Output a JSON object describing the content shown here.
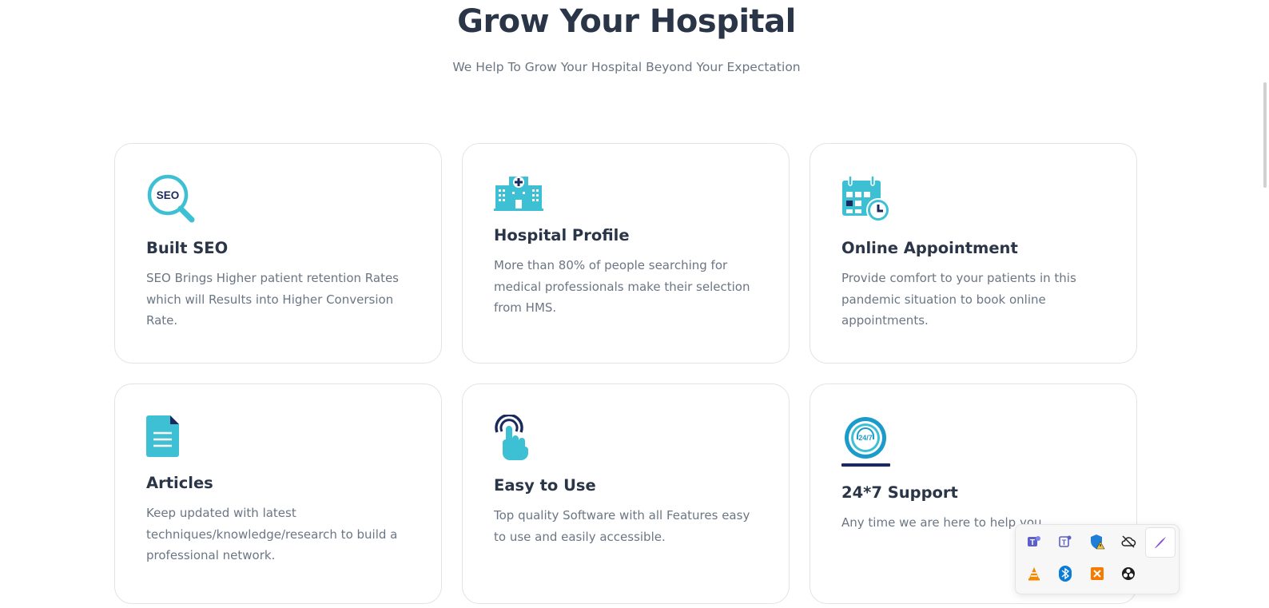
{
  "section": {
    "title": "Grow Your Hospital",
    "subtitle": "We Help To Grow Your Hospital Beyond Your Expectation"
  },
  "cards": [
    {
      "icon": "seo-search-icon",
      "title": "Built SEO",
      "text": "SEO Brings Higher patient retention Rates which will Results into Higher Conversion Rate."
    },
    {
      "icon": "hospital-building-icon",
      "title": "Hospital Profile",
      "text": "More than 80% of people searching for medical professionals make their selection from HMS."
    },
    {
      "icon": "calendar-clock-icon",
      "title": "Online Appointment",
      "text": "Provide comfort to your patients in this pandemic situation to book online appointments."
    },
    {
      "icon": "document-icon",
      "title": "Articles",
      "text": "Keep updated with latest techniques/knowledge/research to build a professional network."
    },
    {
      "icon": "touch-hand-icon",
      "title": "Easy to Use",
      "text": "Top quality Software with all Features easy to use and easily accessible."
    },
    {
      "icon": "support-24-7-icon",
      "title": "24*7 Support",
      "text": "Any time we are here to help you."
    }
  ],
  "system_tray": {
    "icons": [
      "teams-icon",
      "teams-classic-icon",
      "defender-warning-icon",
      "cloud-offline-icon",
      "pen-icon",
      "vlc-icon",
      "bluetooth-icon",
      "xampp-icon",
      "obs-icon"
    ]
  },
  "colors": {
    "accent": "#3dbfd4",
    "navy": "#1b2a5e",
    "heading": "#2a3547",
    "text": "#6b7684",
    "border": "#dfe3ea"
  }
}
